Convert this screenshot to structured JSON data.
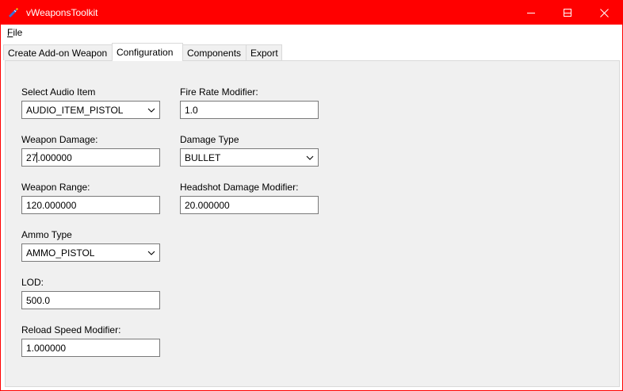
{
  "window": {
    "title": "vWeaponsToolkit",
    "accent_color": "#ff0000",
    "app_icon": "weapon-icon"
  },
  "menu": {
    "file_label_ul": "F",
    "file_label_rest": "ile"
  },
  "tabs": [
    {
      "label": "Create Add-on Weapon",
      "active": false
    },
    {
      "label": "Configuration",
      "active": true
    },
    {
      "label": "Components",
      "active": false
    },
    {
      "label": "Export",
      "active": false
    }
  ],
  "config": {
    "audio_item": {
      "label": "Select Audio Item",
      "value": "AUDIO_ITEM_PISTOL"
    },
    "weapon_damage": {
      "label": "Weapon Damage:",
      "value_before_caret": "27",
      "value_after_caret": ".000000"
    },
    "weapon_range": {
      "label": "Weapon Range:",
      "value": "120.000000"
    },
    "ammo_type": {
      "label": "Ammo Type",
      "value": "AMMO_PISTOL"
    },
    "lod": {
      "label": "LOD:",
      "value": "500.0"
    },
    "reload_speed": {
      "label": "Reload Speed Modifier:",
      "value": "1.000000"
    },
    "fire_rate": {
      "label": "Fire Rate Modifier:",
      "value": "1.0"
    },
    "damage_type": {
      "label": "Damage Type",
      "value": "BULLET"
    },
    "headshot_modifier": {
      "label": "Headshot Damage Modifier:",
      "value": "20.000000"
    }
  }
}
